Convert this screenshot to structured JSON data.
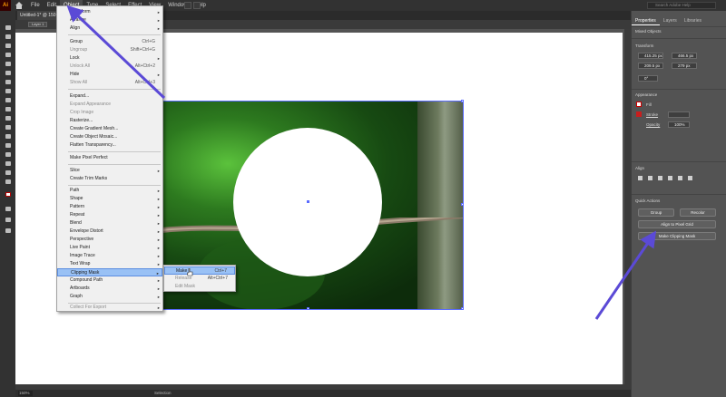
{
  "app": {
    "logo": "Ai"
  },
  "menubar": {
    "items": [
      "File",
      "Edit",
      "Object",
      "Type",
      "Select",
      "Effect",
      "View",
      "Window",
      "Help"
    ],
    "search_placeholder": "Search Adobe Help"
  },
  "document": {
    "tab": "Untitled-1* @ 150 %",
    "layer": "Layer 1"
  },
  "object_menu": {
    "transform": "Transform",
    "arrange": "Arrange",
    "align": "Align",
    "group": "Group",
    "group_sc": "Ctrl+G",
    "ungroup": "Ungroup",
    "ungroup_sc": "Shift+Ctrl+G",
    "lock": "Lock",
    "unlock_all": "Unlock All",
    "unlock_all_sc": "Alt+Ctrl+2",
    "hide": "Hide",
    "show_all": "Show All",
    "show_all_sc": "Alt+Ctrl+3",
    "expand": "Expand...",
    "expand_appearance": "Expand Appearance",
    "crop_image": "Crop Image",
    "rasterize": "Rasterize...",
    "create_gradient_mesh": "Create Gradient Mesh...",
    "create_object_mosaic": "Create Object Mosaic...",
    "flatten_transparency": "Flatten Transparency...",
    "make_pixel_perfect": "Make Pixel Perfect",
    "slice": "Slice",
    "create_trim_marks": "Create Trim Marks",
    "path": "Path",
    "shape": "Shape",
    "pattern": "Pattern",
    "repeat": "Repeat",
    "blend": "Blend",
    "envelope_distort": "Envelope Distort",
    "perspective": "Perspective",
    "live_paint": "Live Paint",
    "image_trace": "Image Trace",
    "text_wrap": "Text Wrap",
    "clipping_mask": "Clipping Mask",
    "compound_path": "Compound Path",
    "artboards": "Artboards",
    "graph": "Graph",
    "collect_for_export": "Collect For Export"
  },
  "clip_submenu": {
    "make": "Make",
    "make_sc": "Ctrl+7",
    "release": "Release",
    "release_sc": "Alt+Ctrl+7",
    "edit_mask": "Edit Mask"
  },
  "panel": {
    "tabs": [
      "Properties",
      "Layers",
      "Libraries"
    ],
    "selection": "Mixed Objects",
    "transform_title": "Transform",
    "x_label": "X:",
    "x_value": "415.25 px",
    "y_label": "Y:",
    "y_value": "209.5 px",
    "w_label": "W:",
    "w_value": "466.5 px",
    "h_label": "H:",
    "h_value": "279 px",
    "angle_value": "0°",
    "appearance_title": "Appearance",
    "fill_label": "Fill",
    "stroke_label": "Stroke",
    "opacity_label": "Opacity",
    "opacity_value": "100%",
    "align_title": "Align",
    "quick_actions_title": "Quick Actions",
    "group_btn": "Group",
    "recolor_btn": "Recolor",
    "align_pixel_btn": "Align to Pixel Grid",
    "make_clip_btn": "Make Clipping Mask"
  },
  "status": {
    "zoom": "150%",
    "mode": "Selection"
  },
  "colors": {
    "accent": "#5b4ad6",
    "menu_highlight": "#99c1f5",
    "selection": "#5a6bff"
  }
}
